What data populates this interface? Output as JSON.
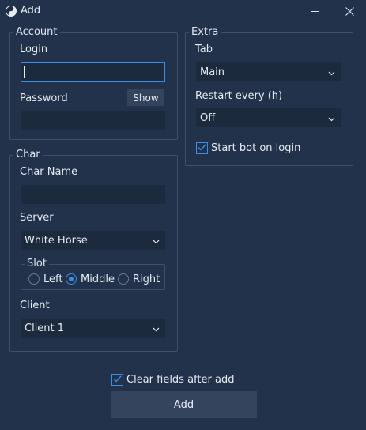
{
  "window": {
    "title": "Add",
    "icon": "yin-yang-icon",
    "controls": {
      "minimize": "minimize-icon",
      "close": "close-icon"
    }
  },
  "account": {
    "legend": "Account",
    "login_label": "Login",
    "login_value": "",
    "password_label": "Password",
    "password_value": "",
    "show_button": "Show"
  },
  "extra": {
    "legend": "Extra",
    "tab_label": "Tab",
    "tab_value": "Main",
    "restart_label": "Restart every (h)",
    "restart_value": "Off",
    "start_bot_label": "Start bot on login",
    "start_bot_checked": true
  },
  "char": {
    "legend": "Char",
    "name_label": "Char Name",
    "name_value": "",
    "server_label": "Server",
    "server_value": "White Horse",
    "slot": {
      "legend": "Slot",
      "options": [
        "Left",
        "Middle",
        "Right"
      ],
      "selected": "Middle"
    },
    "client_label": "Client",
    "client_value": "Client 1"
  },
  "footer": {
    "clear_label": "Clear fields after add",
    "clear_checked": true,
    "add_button": "Add"
  },
  "colors": {
    "background": "#22324a",
    "input_bg": "#1c2a3e",
    "accent": "#3a8ee6",
    "button_bg": "#33445c"
  }
}
